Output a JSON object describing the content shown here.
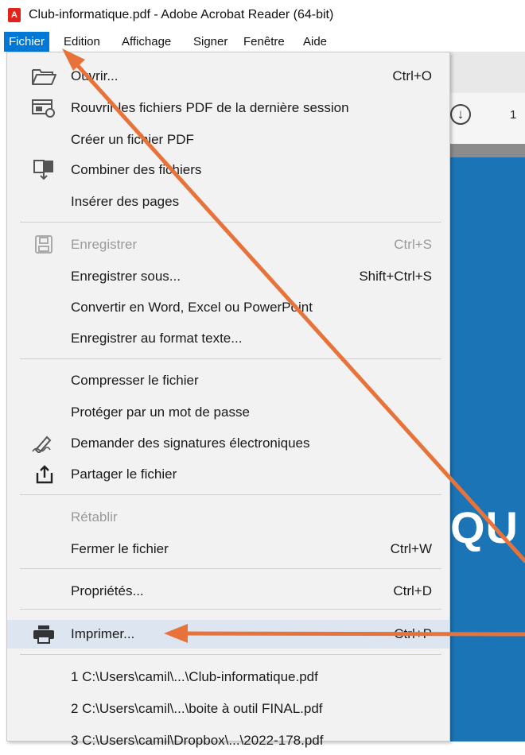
{
  "window": {
    "app_icon_glyph": "A",
    "title": "Club-informatique.pdf - Adobe Acrobat Reader (64-bit)"
  },
  "menubar": {
    "items": [
      "Fichier",
      "Edition",
      "Affichage",
      "Signer",
      "Fenêtre",
      "Aide"
    ],
    "active": "Fichier"
  },
  "background": {
    "page_number": "1",
    "download_glyph": "↓",
    "doc_text": "QU"
  },
  "file_menu": {
    "items": [
      {
        "label": "Ouvrir...",
        "shortcut": "Ctrl+O",
        "icon": "folder-open-icon"
      },
      {
        "label": "Rouvrir les fichiers PDF de la dernière session",
        "shortcut": "",
        "icon": "reopen-session-icon"
      },
      {
        "label": "Créer un fichier PDF",
        "shortcut": ""
      },
      {
        "label": "Combiner des fichiers",
        "shortcut": "",
        "icon": "combine-files-icon"
      },
      {
        "label": "Insérer des pages",
        "shortcut": ""
      },
      {
        "label": "Enregistrer",
        "shortcut": "Ctrl+S",
        "icon": "save-icon",
        "disabled": true
      },
      {
        "label": "Enregistrer sous...",
        "shortcut": "Shift+Ctrl+S"
      },
      {
        "label": "Convertir en Word, Excel ou PowerPoint",
        "shortcut": ""
      },
      {
        "label": "Enregistrer au format texte...",
        "shortcut": ""
      },
      {
        "label": "Compresser le fichier",
        "shortcut": ""
      },
      {
        "label": "Protéger par un mot de passe",
        "shortcut": ""
      },
      {
        "label": "Demander des signatures électroniques",
        "shortcut": "",
        "icon": "signature-icon"
      },
      {
        "label": "Partager le fichier",
        "shortcut": "",
        "icon": "share-icon"
      },
      {
        "label": "Rétablir",
        "shortcut": "",
        "disabled": true
      },
      {
        "label": "Fermer le fichier",
        "shortcut": "Ctrl+W"
      },
      {
        "label": "Propriétés...",
        "shortcut": "Ctrl+D"
      },
      {
        "label": "Imprimer...",
        "shortcut": "Ctrl+P",
        "icon": "printer-icon",
        "highlighted": true
      },
      {
        "label": "1 C:\\Users\\camil\\...\\Club-informatique.pdf",
        "shortcut": ""
      },
      {
        "label": "2 C:\\Users\\camil\\...\\boite à outil FINAL.pdf",
        "shortcut": ""
      },
      {
        "label": "3 C:\\Users\\camil\\Dropbox\\...\\2022-178.pdf",
        "shortcut": ""
      }
    ]
  },
  "colors": {
    "menu_active": "#0078d7",
    "annotation_arrow": "#e8733a",
    "doc_background": "#1a74b6"
  }
}
